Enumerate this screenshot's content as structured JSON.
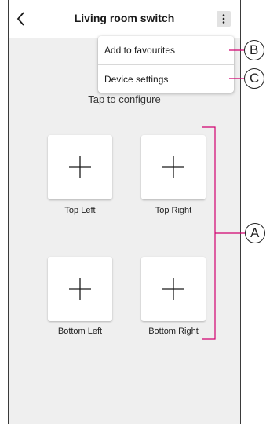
{
  "header": {
    "title": "Living room switch"
  },
  "menu": {
    "items": [
      {
        "label": "Add to favourites"
      },
      {
        "label": "Device settings"
      }
    ]
  },
  "main": {
    "hint": "Tap to configure",
    "buttons": [
      {
        "label": "Top Left"
      },
      {
        "label": "Top Right"
      },
      {
        "label": "Bottom Left"
      },
      {
        "label": "Bottom Right"
      }
    ]
  },
  "callouts": {
    "a": "A",
    "b": "B",
    "c": "C"
  },
  "colors": {
    "panel_background": "#efefef",
    "accent_callout": "#d1006f"
  },
  "icons": {
    "back": "chevron-left-icon",
    "more": "more-vertical-icon",
    "add": "plus-icon"
  }
}
